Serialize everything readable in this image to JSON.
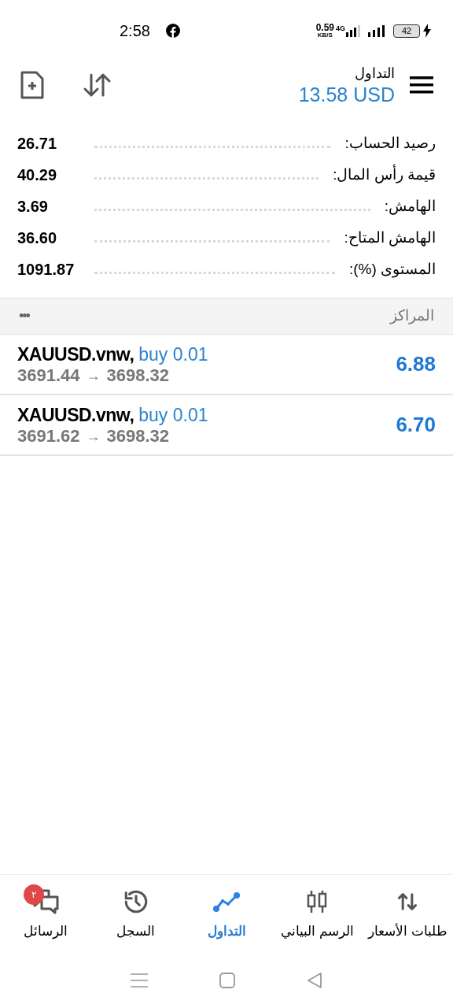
{
  "status_bar": {
    "time": "2:58",
    "speed": "0.59",
    "speed_unit": "KB/S",
    "network": "4G",
    "battery": "42"
  },
  "header": {
    "title": "التداول",
    "balance": "13.58 USD"
  },
  "summary": [
    {
      "label": "رصيد الحساب:",
      "value": "26.71"
    },
    {
      "label": "قيمة رأس المال:",
      "value": "40.29"
    },
    {
      "label": "الهامش:",
      "value": "3.69"
    },
    {
      "label": "الهامش المتاح:",
      "value": "36.60"
    },
    {
      "label": "المستوى (%):",
      "value": "1091.87"
    }
  ],
  "positions_header": {
    "title": "المراكز",
    "more": "•••"
  },
  "positions": [
    {
      "symbol": "XAUUSD.vnw,",
      "order": "buy 0.01",
      "open": "3691.44",
      "arrow": "→",
      "current": "3698.32",
      "profit": "6.88"
    },
    {
      "symbol": "XAUUSD.vnw,",
      "order": "buy 0.01",
      "open": "3691.62",
      "arrow": "→",
      "current": "3698.32",
      "profit": "6.70"
    }
  ],
  "bottom_nav": [
    {
      "kind": "quotes",
      "label": "طلبات الأسعار",
      "selected": false
    },
    {
      "kind": "chart",
      "label": "الرسم البياني",
      "selected": false
    },
    {
      "kind": "trade",
      "label": "التداول",
      "selected": true
    },
    {
      "kind": "history",
      "label": "السجل",
      "selected": false
    },
    {
      "kind": "messages",
      "label": "الرسائل",
      "badge": "٢",
      "selected": false
    }
  ]
}
